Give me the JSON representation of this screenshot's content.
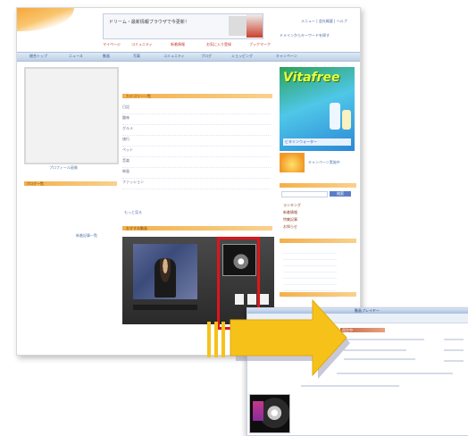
{
  "banner": {
    "text": "ドリーム・最新情報ブラウザで今更新！"
  },
  "header": {
    "top_links": "メニュー | 会社概要 | ヘルプ",
    "search_link": "ドメインからキーワードを探す",
    "menu": [
      "マイページ",
      "コミュニティ",
      "新着情報",
      "お気に入り登録",
      "ブックマーク"
    ]
  },
  "nav": {
    "items": [
      "総合トップ",
      "ニュース",
      "動画",
      "写真",
      "コミュニティ",
      "ブログ",
      "ショッピング",
      "キャンペーン"
    ]
  },
  "left": {
    "caption": "プロフィール画像",
    "section_title": "ブログ一覧",
    "link": "新着記事一覧"
  },
  "main": {
    "list_title": "カテゴリー一覧",
    "list_items": [
      "日記",
      "趣味",
      "グルメ",
      "旅行",
      "ペット",
      "音楽",
      "映画",
      "ファッション"
    ],
    "more_link": "もっと見る",
    "video_section_title": "おすすめ動画"
  },
  "right": {
    "ad_title": "Vitafree",
    "ad_sub": "ビタミンウォーター",
    "small_ad_text": "キャンペーン実施中",
    "box_title": "検索",
    "list": [
      "ランキング",
      "新着情報",
      "特集記事",
      "お知らせ"
    ]
  },
  "popup": {
    "title_bar": "動画プレイヤー",
    "tab_label": "再生中"
  },
  "colors": {
    "highlight": "#e0141a",
    "arrow": "#f6c21a",
    "nav": "#bcd0e6",
    "accent": "#f4b04a"
  }
}
